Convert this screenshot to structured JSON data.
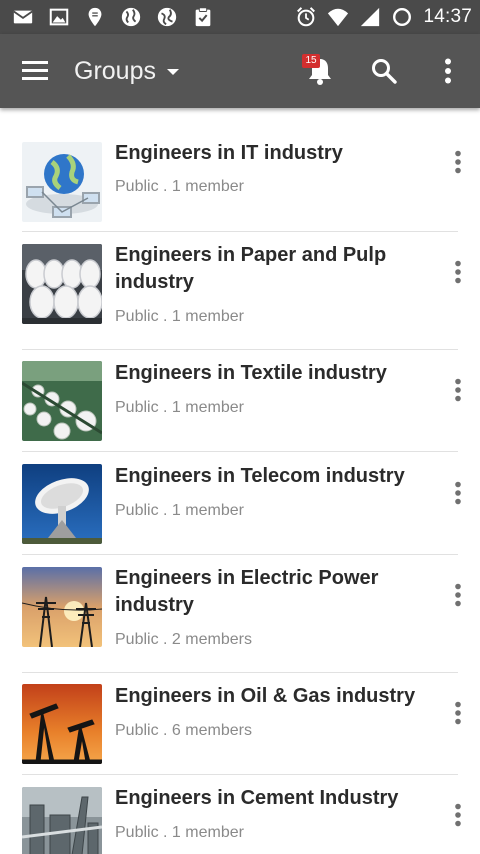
{
  "status_bar": {
    "left_icons": [
      "mail-icon",
      "image-icon",
      "location-icon",
      "globe-icon",
      "globe-icon",
      "clipboard-check-icon"
    ],
    "right_icons": [
      "alarm-icon",
      "wifi-icon",
      "signal-icon",
      "battery-icon"
    ],
    "time": "14:37"
  },
  "app_bar": {
    "title": "Groups",
    "notification_count": "15",
    "colors": {
      "background": "#555555",
      "badge": "#d32f2f"
    }
  },
  "groups": [
    {
      "name": "Engineers in IT industry",
      "meta": "Public . 1 member",
      "image": "network-globe-image"
    },
    {
      "name": "Engineers in Paper and Pulp industry",
      "meta": "Public . 1 member",
      "image": "paper-rolls-image"
    },
    {
      "name": "Engineers in Textile industry",
      "meta": "Public . 1 member",
      "image": "textile-spools-image"
    },
    {
      "name": "Engineers in Telecom industry",
      "meta": "Public . 1 member",
      "image": "satellite-dish-image"
    },
    {
      "name": "Engineers in Electric Power industry",
      "meta": "Public . 2 members",
      "image": "power-pylons-image"
    },
    {
      "name": "Engineers in Oil & Gas industry",
      "meta": "Public . 6 members",
      "image": "oil-pumpjacks-image"
    },
    {
      "name": "Engineers in Cement Industry",
      "meta": "Public . 1 member",
      "image": "cement-plant-image"
    }
  ]
}
